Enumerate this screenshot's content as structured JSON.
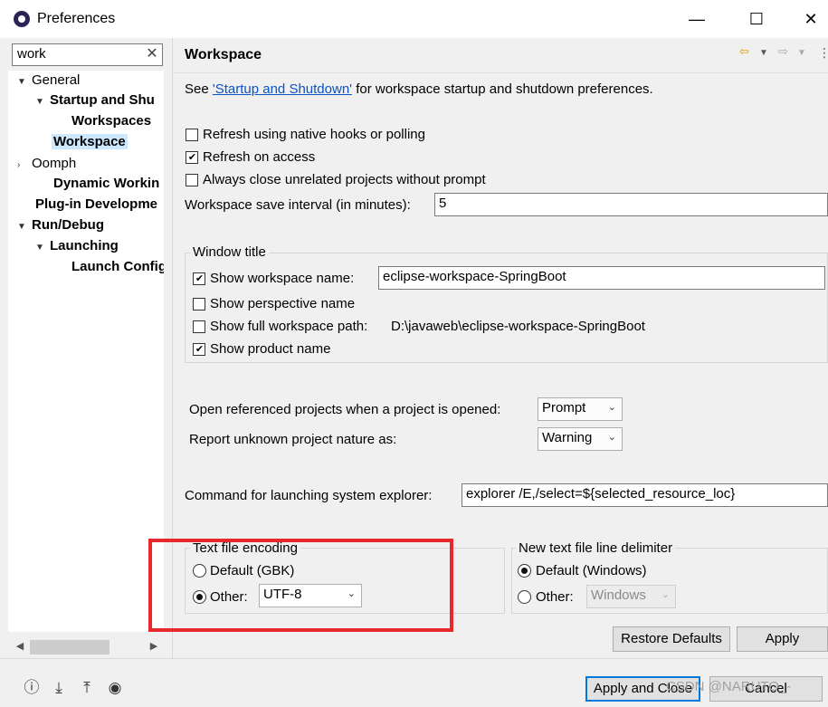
{
  "window": {
    "title": "Preferences"
  },
  "filter": {
    "value": "work"
  },
  "tree": {
    "general": "General",
    "startup": "Startup and Shu",
    "workspaces": "Workspaces",
    "workspace": "Workspace",
    "oomph": "Oomph",
    "dynamic": "Dynamic Workin",
    "plugin": "Plug-in Developme",
    "rundebug": "Run/Debug",
    "launching": "Launching",
    "launch_config": "Launch Config"
  },
  "page": {
    "title": "Workspace",
    "see_prefix": "See ",
    "see_link": "'Startup and Shutdown'",
    "see_suffix": " for workspace startup and shutdown preferences."
  },
  "options": {
    "refresh_native": "Refresh using native hooks or polling",
    "refresh_access": "Refresh on access",
    "always_close": "Always close unrelated projects without prompt",
    "save_interval_label": "Workspace save interval (in minutes):",
    "save_interval_value": "5"
  },
  "window_title_group": {
    "label": "Window title",
    "show_workspace_name": "Show workspace name:",
    "workspace_name_value": "eclipse-workspace-SpringBoot",
    "show_perspective": "Show perspective name",
    "show_full_path": "Show full workspace path:",
    "full_path_value": "D:\\javaweb\\eclipse-workspace-SpringBoot",
    "show_product": "Show product name"
  },
  "projects": {
    "open_ref_label": "Open referenced projects when a project is opened:",
    "open_ref_value": "Prompt",
    "report_label": "Report unknown project nature as:",
    "report_value": "Warning"
  },
  "explorer": {
    "label": "Command for launching system explorer:",
    "value": "explorer /E,/select=${selected_resource_loc}"
  },
  "encoding": {
    "group_label": "Text file encoding",
    "default_label": "Default (GBK)",
    "other_label": "Other:",
    "other_value": "UTF-8"
  },
  "delimiter": {
    "group_label": "New text file line delimiter",
    "default_label": "Default (Windows)",
    "other_label": "Other:",
    "other_value": "Windows"
  },
  "buttons": {
    "restore": "Restore Defaults",
    "apply": "Apply",
    "apply_close": "Apply and Close",
    "cancel": "Cancel"
  },
  "watermark": "CSDN @NARUTO_-",
  "colors": {
    "highlight": "#e8282c",
    "link": "#0a53c7",
    "selection": "#cce8ff"
  }
}
